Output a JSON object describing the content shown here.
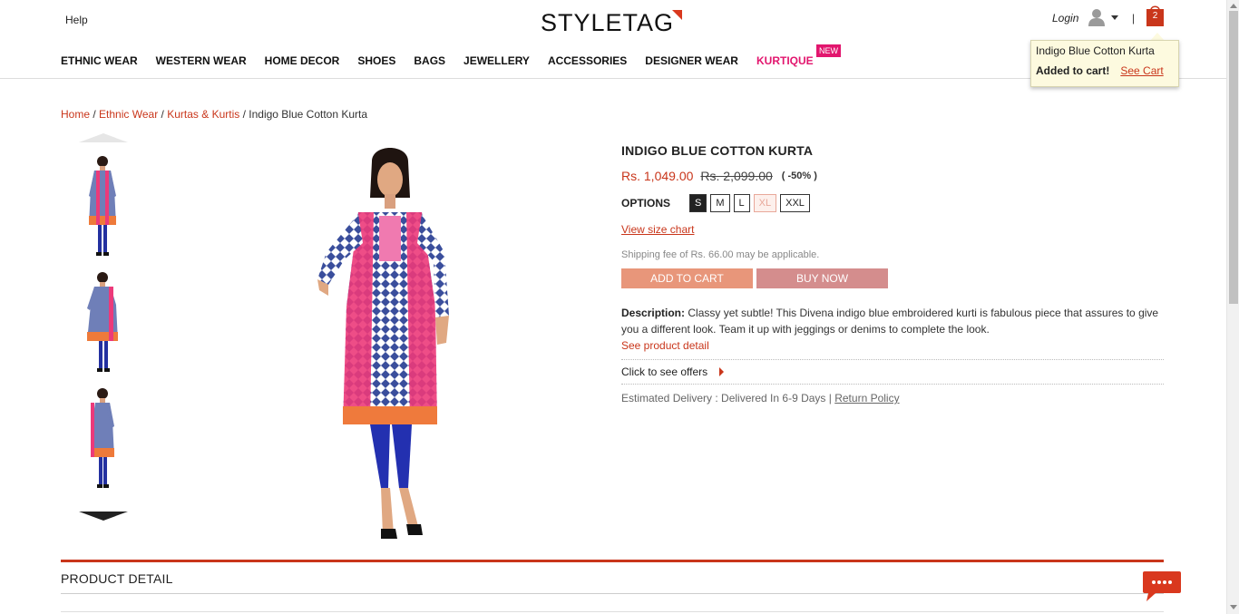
{
  "header": {
    "help": "Help",
    "logo": "STYLETAG",
    "login": "Login",
    "separator": "|",
    "cart_count": "2"
  },
  "nav": {
    "items": [
      "ETHNIC WEAR",
      "WESTERN WEAR",
      "HOME DECOR",
      "SHOES",
      "BAGS",
      "JEWELLERY",
      "ACCESSORIES",
      "DESIGNER WEAR",
      "KURTIQUE"
    ],
    "new_badge": "NEW"
  },
  "cart_popup": {
    "product": "Indigo Blue Cotton Kurta",
    "added": "Added to cart!",
    "see_cart": "See Cart"
  },
  "breadcrumb": {
    "items": [
      "Home",
      "Ethnic Wear",
      "Kurtas & Kurtis"
    ],
    "current": "Indigo Blue Cotton Kurta",
    "sep": "/"
  },
  "product": {
    "title": "INDIGO BLUE COTTON KURTA",
    "price": "Rs. 1,049.00",
    "mrp": "Rs. 2,099.00",
    "discount": "( -50% )",
    "options_label": "OPTIONS",
    "sizes": [
      {
        "label": "S",
        "state": "selected"
      },
      {
        "label": "M",
        "state": "available"
      },
      {
        "label": "L",
        "state": "available"
      },
      {
        "label": "XL",
        "state": "unavailable"
      },
      {
        "label": "XXL",
        "state": "available"
      }
    ],
    "size_chart": "View size chart",
    "shipping": "Shipping fee of Rs. 66.00 may be applicable.",
    "add_to_cart": "ADD TO CART",
    "buy_now": "BUY NOW",
    "description_label": "Description:",
    "description": "Classy yet subtle! This Divena indigo blue embroidered kurti is fabulous piece that assures to give you a different look. Team it up with jeggings or denims to complete the look.",
    "see_detail": "See product detail",
    "offers": "Click to see offers",
    "delivery": "Estimated Delivery : Delivered In 6-9 Days |",
    "return_policy": "Return Policy"
  },
  "product_detail": {
    "title": "PRODUCT DETAIL"
  },
  "colors": {
    "accent": "#c9361b",
    "kurtique": "#e2166e",
    "add_to_cart_bg": "#e8967a",
    "buy_now_bg": "#d48d8d",
    "popup_bg": "#fdfadf"
  },
  "icons": [
    "user-icon",
    "chevron-down-icon",
    "shopping-bag-icon",
    "arrow-up-icon",
    "arrow-down-icon",
    "caret-right-icon",
    "chat-icon"
  ]
}
